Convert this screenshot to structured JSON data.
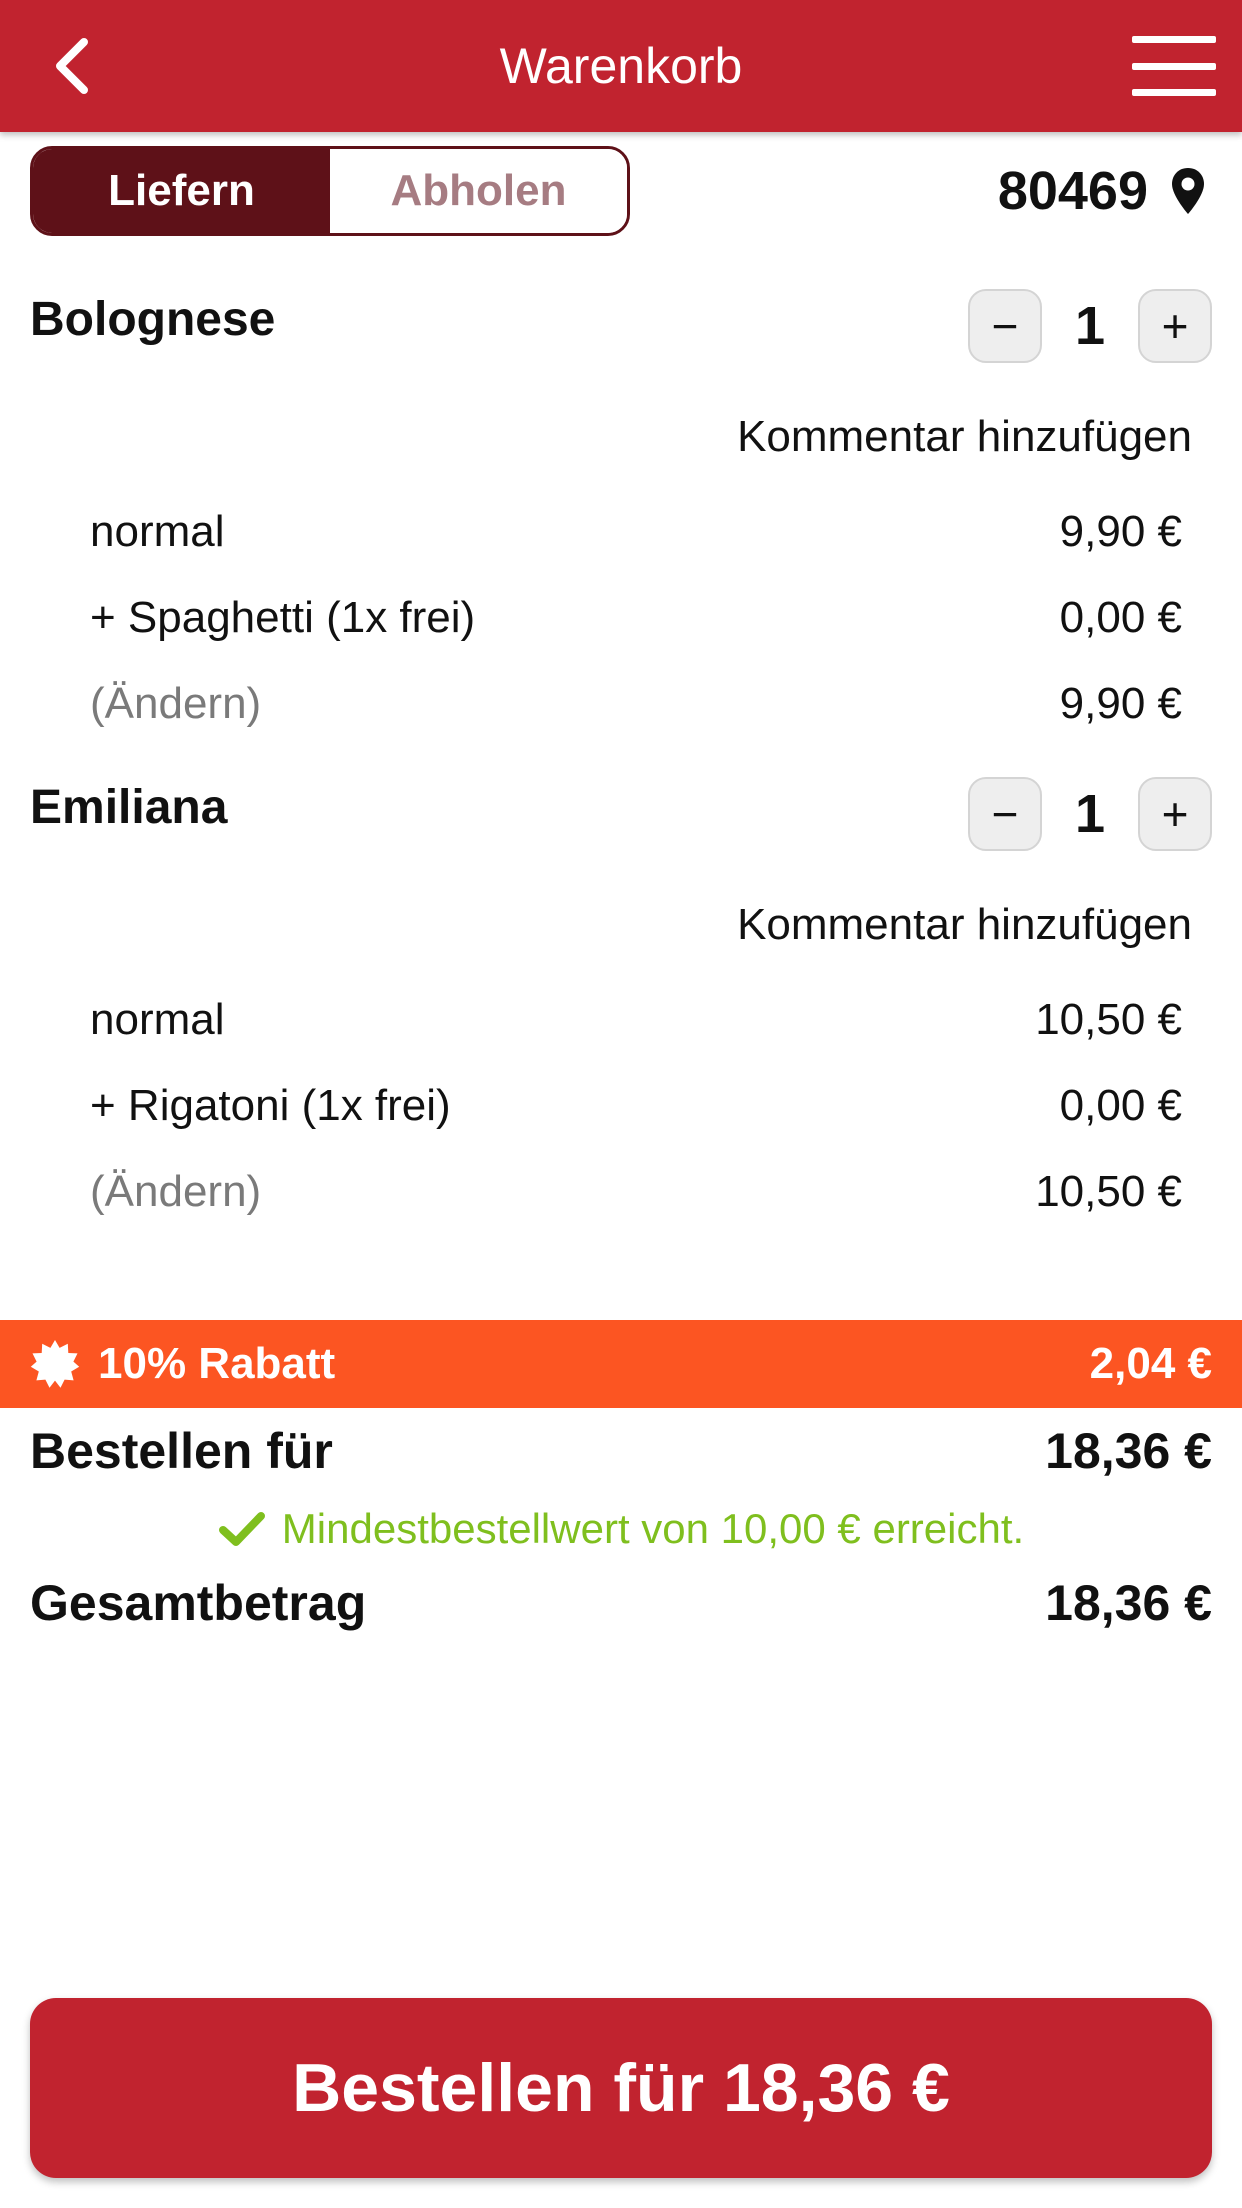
{
  "header": {
    "title": "Warenkorb",
    "back_icon": "chevron-left-icon",
    "menu_icon": "hamburger-menu-icon"
  },
  "delivery_toggle": {
    "options": [
      "Liefern",
      "Abholen"
    ],
    "selected": "Liefern"
  },
  "location": {
    "postcode": "80469",
    "icon": "map-pin-icon"
  },
  "cart": {
    "items": [
      {
        "name": "Bolognese",
        "quantity": "1",
        "minus": "−",
        "plus": "+",
        "comment_label": "Kommentar hinzufügen",
        "lines": [
          {
            "label": "normal",
            "price": "9,90 €"
          },
          {
            "label": "+ Spaghetti (1x frei)",
            "price": "0,00 €"
          },
          {
            "label": "(Ändern)",
            "price": "9,90 €"
          }
        ]
      },
      {
        "name": "Emiliana",
        "quantity": "1",
        "minus": "−",
        "plus": "+",
        "comment_label": "Kommentar hinzufügen",
        "lines": [
          {
            "label": "normal",
            "price": "10,50 €"
          },
          {
            "label": "+ Rigatoni (1x frei)",
            "price": "0,00 €"
          },
          {
            "label": "(Ändern)",
            "price": "10,50 €"
          }
        ]
      }
    ]
  },
  "discount": {
    "label": "10% Rabatt",
    "amount": "2,04 €",
    "icon": "discount-badge-icon",
    "color": "#fc5522"
  },
  "summary": {
    "order_label": "Bestellen für",
    "order_value": "18,36 €",
    "minimum_message": "Mindestbestellwert von 10,00 € erreicht.",
    "minimum_icon": "checkmark-icon",
    "minimum_color": "#7fbf1e",
    "total_label": "Gesamtbetrag",
    "total_value": "18,36 €"
  },
  "order_button": {
    "label": "Bestellen für 18,36 €"
  },
  "colors": {
    "brand": "#c1232f",
    "toggle_active": "#5e1118"
  }
}
